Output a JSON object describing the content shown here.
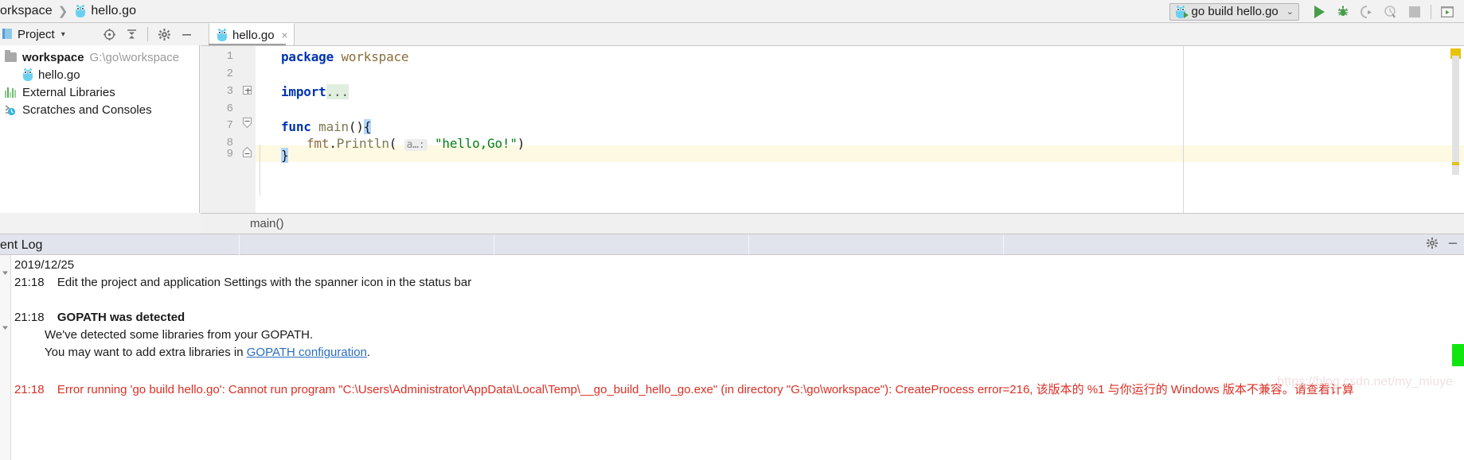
{
  "window": {
    "breadcrumb": {
      "project": "orkspace",
      "file": "hello.go",
      "separator": "❯"
    }
  },
  "toolbar": {
    "run_config_label": "go build hello.go",
    "run_config_caret": "⌄",
    "buttons": [
      {
        "name": "run-button",
        "label": "Run"
      },
      {
        "name": "debug-button",
        "label": "Debug"
      },
      {
        "name": "run-with-coverage-button",
        "label": "Run with Coverage"
      },
      {
        "name": "profile-button",
        "label": "Profile"
      },
      {
        "name": "stop-button",
        "label": "Stop"
      },
      {
        "name": "restore-layout-button",
        "label": "Restore Layout"
      }
    ]
  },
  "project_panel": {
    "title": "Project",
    "caret": "▾",
    "tools": [
      {
        "name": "locate-icon",
        "label": "Select Opened File"
      },
      {
        "name": "collapse-all-icon",
        "label": "Collapse All"
      },
      {
        "name": "gear-icon",
        "label": "Settings"
      },
      {
        "name": "minimize-icon",
        "label": "Hide"
      }
    ],
    "tree": [
      {
        "label": "workspace",
        "path": "G:\\go\\workspace",
        "icon": "folder-icon",
        "bold": true,
        "indent": 0
      },
      {
        "label": "hello.go",
        "path": "",
        "icon": "go-file-icon",
        "bold": false,
        "indent": 1
      },
      {
        "label": "External Libraries",
        "path": "",
        "icon": "libraries-icon",
        "bold": false,
        "indent": 0
      },
      {
        "label": "Scratches and Consoles",
        "path": "",
        "icon": "scratches-icon",
        "bold": false,
        "indent": 0
      }
    ]
  },
  "editor": {
    "tab": {
      "label": "hello.go",
      "close": "×"
    },
    "line_numbers": [
      "1",
      "2",
      "3",
      "6",
      "7",
      "8",
      "9"
    ],
    "code": {
      "l1_kw": "package",
      "l1_name": "workspace",
      "l3_kw": "import",
      "l3_fold": "...",
      "l7_kw": "func",
      "l7_name": "main",
      "l7_parens": "()",
      "l7_brace": "{",
      "l8_recv": "fmt",
      "l8_dot": ".",
      "l8_call": "Println",
      "l8_open": "( ",
      "l8_hint": "a…:",
      "l8_str": "\"hello,Go!\"",
      "l8_close": ")",
      "l9_brace": "}"
    },
    "breadcrumb": "main()",
    "current_line": "9",
    "marker_color": "#e8c300"
  },
  "event_log": {
    "title": "ent Log",
    "tools": [
      {
        "name": "gear-icon",
        "label": "Settings"
      },
      {
        "name": "minimize-icon",
        "label": "Hide"
      }
    ],
    "entries": [
      {
        "time": "",
        "text": "2019/12/25",
        "kind": "date"
      },
      {
        "time": "21:18",
        "text": "Edit the project and application Settings with the spanner icon in the status bar",
        "kind": "info"
      },
      {
        "time": "21:18",
        "text": "GOPATH was detected",
        "kind": "bold"
      },
      {
        "time": "",
        "text": "We've detected some libraries from your GOPATH.",
        "kind": "sub"
      },
      {
        "time": "",
        "text_before": "You may want to add extra libraries in ",
        "link": "GOPATH configuration",
        "text_after": ".",
        "kind": "sub-link"
      },
      {
        "time": "21:18",
        "text": "Error running 'go build hello.go': Cannot run program \"C:\\Users\\Administrator\\AppData\\Local\\Temp\\__go_build_hello_go.exe\" (in directory \"G:\\go\\workspace\"): CreateProcess error=216, 该版本的 %1 与你运行的 Windows 版本不兼容。请查看计算",
        "kind": "error"
      }
    ],
    "watermark": "https://blog.csdn.net/my_miuye",
    "status_flag_color": "#11e611"
  },
  "colors": {
    "accent_green": "#499c4a",
    "error_red": "#d93025",
    "link_blue": "#2a6dc0",
    "warn_yellow": "#e8c300",
    "panel_bg": "#e1e4ec"
  }
}
